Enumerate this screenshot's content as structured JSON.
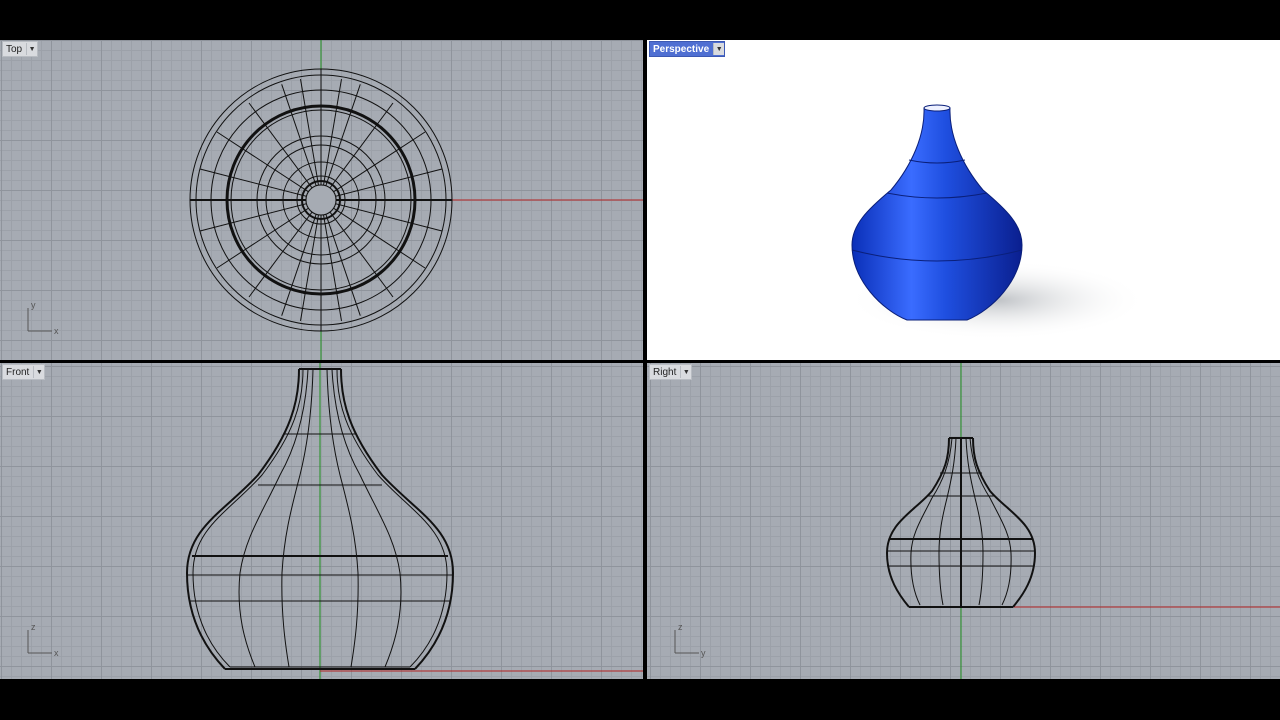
{
  "viewports": {
    "top": {
      "label": "Top",
      "axis1": "y",
      "axis2": "x"
    },
    "perspective": {
      "label": "Perspective"
    },
    "front": {
      "label": "Front",
      "axis1": "z",
      "axis2": "x"
    },
    "right": {
      "label": "Right",
      "axis1": "z",
      "axis2": "y"
    }
  },
  "colors": {
    "active_viewport_label": "#4f6fd2",
    "vase": "#1f4fe0",
    "x_axis": "#b22222",
    "y_axis": "#1f8f1f",
    "grid_bg": "#a6abb3"
  },
  "icons": {
    "dropdown": "chevron-down-icon"
  }
}
